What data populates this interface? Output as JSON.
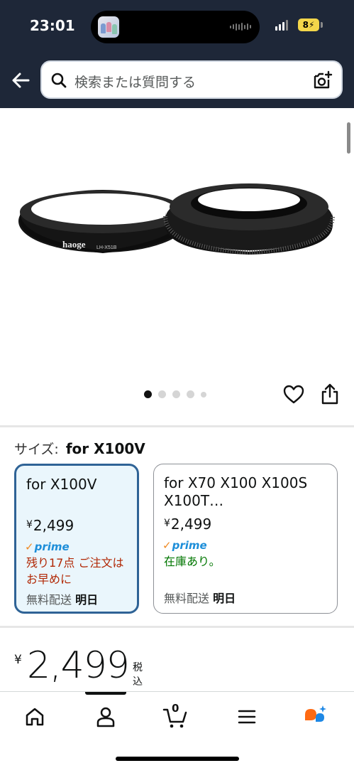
{
  "status_bar": {
    "time": "23:01",
    "battery": "8"
  },
  "header": {
    "search_placeholder": "検索または質問する",
    "icons": [
      "back-arrow-icon",
      "search-icon",
      "camera-search-icon"
    ]
  },
  "product_image": {
    "brand_text": "haoge",
    "model_text": "LH-X51B",
    "carousel_total": 5,
    "carousel_active": 1
  },
  "size_section": {
    "label": "サイズ:",
    "selected": "for X100V",
    "options": [
      {
        "title": "for X100V",
        "price": "2,499",
        "currency": "¥",
        "prime": "prime",
        "availability": "残り17点 ご注文はお早めに",
        "shipping_label": "無料配送",
        "shipping_day": "明日"
      },
      {
        "title": "for X70 X100 X100S X100T…",
        "price": "2,499",
        "currency": "¥",
        "prime": "prime",
        "availability": "在庫あり。",
        "shipping_label": "無料配送",
        "shipping_day": "明日"
      }
    ]
  },
  "price": {
    "currency": "¥",
    "amount": "2,499",
    "tax_note": "税込"
  },
  "bottom_nav": {
    "cart_count": "0",
    "items": [
      "home-icon",
      "account-icon",
      "cart-icon",
      "menu-icon",
      "rufus-ai-icon"
    ]
  },
  "colors": {
    "header_bg": "#1e2738",
    "selected_border": "#2f6396",
    "selected_bg": "#eaf6fc",
    "prime_blue": "#1d8ed9",
    "urgent_red": "#b12704",
    "instock_green": "#007600"
  }
}
